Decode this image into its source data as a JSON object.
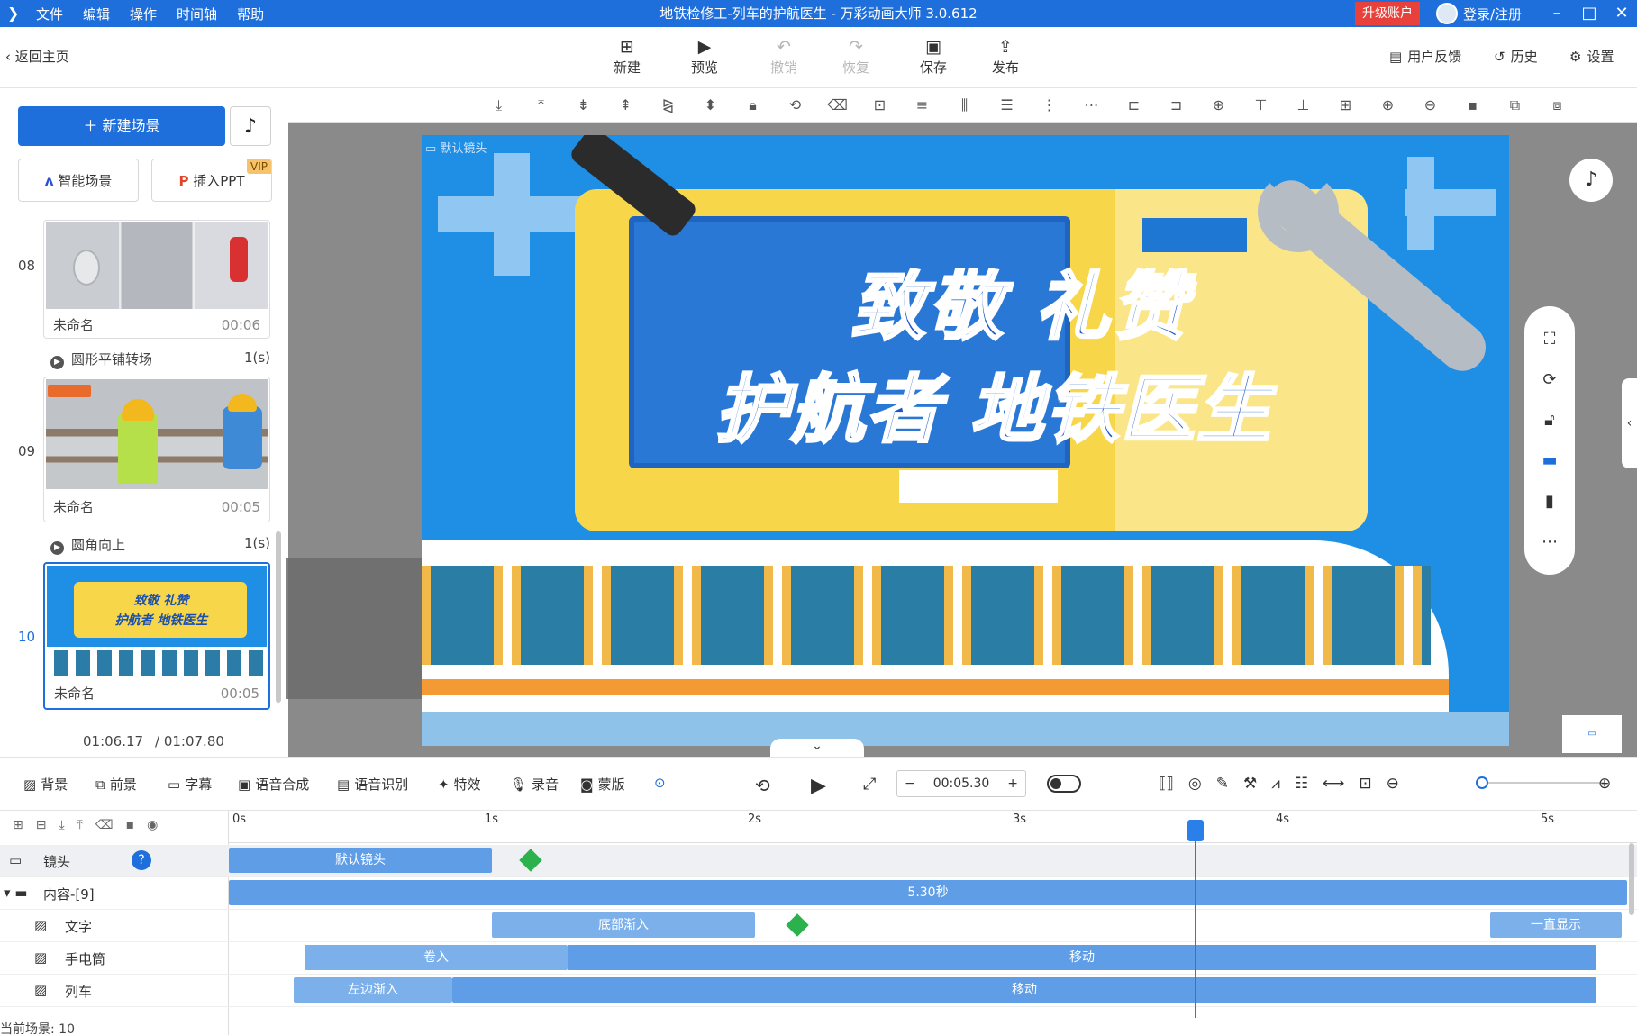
{
  "titlebar": {
    "menu": [
      "文件",
      "编辑",
      "操作",
      "时间轴",
      "帮助"
    ],
    "title": "地铁检修工-列车的护航医生 - 万彩动画大师 3.0.612",
    "upgrade": "升级账户",
    "login": "登录/注册"
  },
  "toolbar": {
    "back": "返回主页",
    "buttons": [
      {
        "label": "新建",
        "icon": "plus-icon"
      },
      {
        "label": "预览",
        "icon": "play-icon"
      },
      {
        "label": "撤销",
        "icon": "undo-icon"
      },
      {
        "label": "恢复",
        "icon": "redo-icon"
      },
      {
        "label": "保存",
        "icon": "save-icon"
      },
      {
        "label": "发布",
        "icon": "publish-icon"
      }
    ],
    "right": [
      "用户反馈",
      "历史",
      "设置"
    ]
  },
  "left": {
    "new_scene": "新建场景",
    "smart_scene": "智能场景",
    "insert_ppt": "插入PPT",
    "vip": "VIP",
    "scenes": [
      {
        "num": "08",
        "name": "未命名",
        "duration": "00:06",
        "transition": "圆形平铺转场",
        "trans_time": "1(s)"
      },
      {
        "num": "09",
        "name": "未命名",
        "duration": "00:05",
        "transition": "圆角向上",
        "trans_time": "1(s)"
      },
      {
        "num": "10",
        "name": "未命名",
        "duration": "00:05"
      }
    ],
    "time_current": "01:06.17",
    "time_total": "/ 01:07.80"
  },
  "canvas": {
    "camera_label": "默认镜头",
    "line1": "致敬  礼赞",
    "line2": "护航者  地铁医生"
  },
  "bottom_toolbar": {
    "tools": [
      "背景",
      "前景",
      "字幕",
      "语音合成",
      "语音识别",
      "特效",
      "录音",
      "蒙版"
    ],
    "time": "00:05.30"
  },
  "timeline": {
    "ruler": [
      "0s",
      "1s",
      "2s",
      "3s",
      "4s",
      "5s"
    ],
    "tracks": [
      {
        "name": "镜头",
        "clips": [
          {
            "label": "默认镜头"
          }
        ]
      },
      {
        "name": "内容-[9]",
        "clips": [
          {
            "label": "5.30秒"
          }
        ]
      },
      {
        "name": "文字",
        "clips": [
          {
            "label": "底部渐入"
          },
          {
            "label": "一直显示"
          }
        ]
      },
      {
        "name": "手电筒",
        "clips": [
          {
            "label": "卷入"
          },
          {
            "label": "移动"
          }
        ]
      },
      {
        "name": "列车",
        "clips": [
          {
            "label": "左边渐入"
          },
          {
            "label": "移动"
          }
        ]
      }
    ],
    "status": "当前场景: 10"
  }
}
